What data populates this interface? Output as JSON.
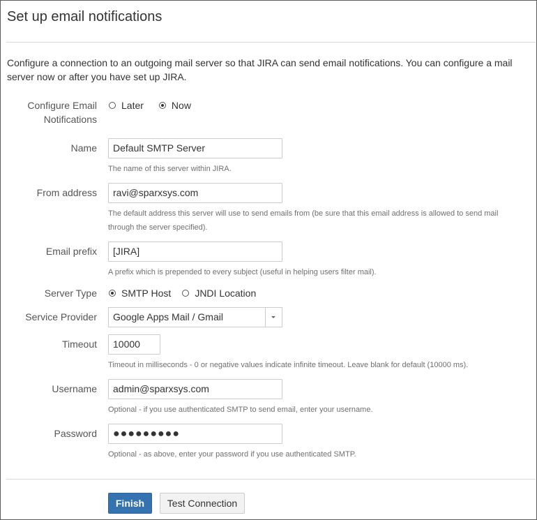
{
  "page": {
    "title": "Set up email notifications"
  },
  "intro": "Configure a connection to an outgoing mail server so that JIRA can send email notifications. You can configure a mail server now or after you have set up JIRA.",
  "configure": {
    "label_line1": "Configure Email",
    "label_line2": "Notifications",
    "options": [
      {
        "label": "Later",
        "selected": false
      },
      {
        "label": "Now",
        "selected": true
      }
    ]
  },
  "name": {
    "label": "Name",
    "value": "Default SMTP Server",
    "help": "The name of this server within JIRA."
  },
  "from_address": {
    "label": "From address",
    "value": "ravi@sparxsys.com",
    "help_line1": "The default address this server will use to send emails from (be sure that this email address is allowed to send mail",
    "help_line2": "through the server specified)."
  },
  "email_prefix": {
    "label": "Email prefix",
    "value": "[JIRA]",
    "help": "A prefix which is prepended to every subject (useful in helping users filter mail)."
  },
  "server_type": {
    "label": "Server Type",
    "options": [
      {
        "label": "SMTP Host",
        "selected": true
      },
      {
        "label": "JNDI Location",
        "selected": false
      }
    ]
  },
  "service_provider": {
    "label": "Service Provider",
    "value": "Google Apps Mail / Gmail"
  },
  "timeout": {
    "label": "Timeout",
    "value": "10000",
    "help": "Timeout in milliseconds - 0 or negative values indicate infinite timeout. Leave blank for default (10000 ms)."
  },
  "username": {
    "label": "Username",
    "value": "admin@sparxsys.com",
    "help": "Optional - if you use authenticated SMTP to send email, enter your username."
  },
  "password": {
    "label": "Password",
    "value": "●●●●●●●●●",
    "help": "Optional - as above, enter your password if you use authenticated SMTP."
  },
  "buttons": {
    "finish": "Finish",
    "test_connection": "Test Connection"
  },
  "colors": {
    "primary_button": "#3572b0",
    "text": "#333333",
    "help_text": "#707070",
    "border": "#5a5a5a"
  }
}
